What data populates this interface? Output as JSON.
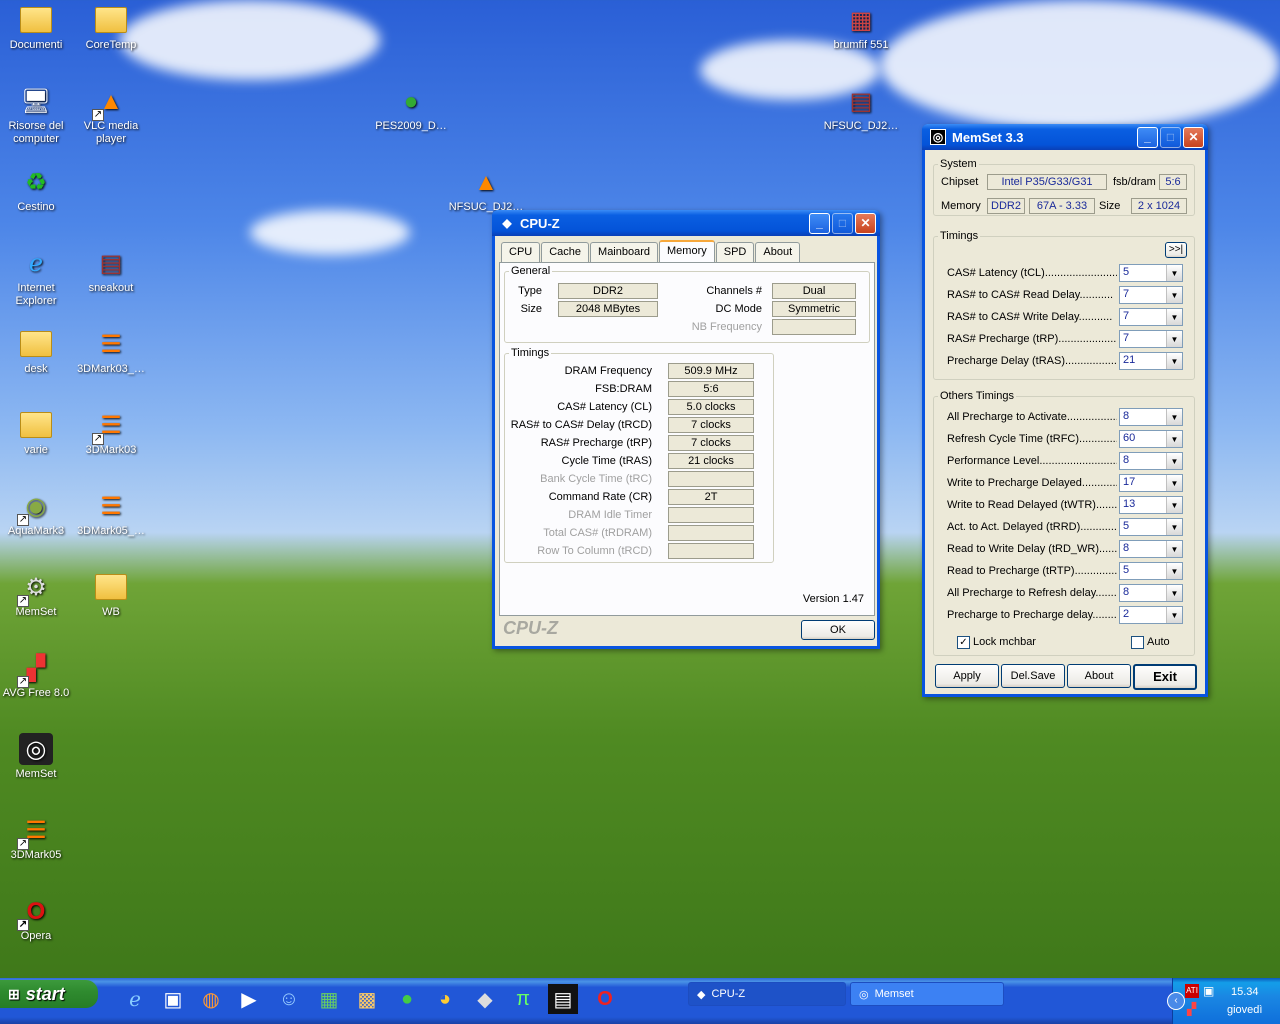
{
  "desktop": {
    "icons": [
      {
        "label": "Documenti",
        "icon": "folder-docs-icon"
      },
      {
        "label": "CoreTemp",
        "icon": "folder-icon"
      },
      {
        "label": "brumfif 551",
        "icon": "file-icon"
      },
      {
        "label": "Risorse del computer",
        "icon": "computer-icon"
      },
      {
        "label": "VLC media player",
        "icon": "vlc-icon"
      },
      {
        "label": "PES2009_D…",
        "icon": "utorrent-icon"
      },
      {
        "label": "NFSUC_DJ2…",
        "icon": "rar-icon"
      },
      {
        "label": "Cestino",
        "icon": "recycle-bin-icon"
      },
      {
        "label": "NFSUC_DJ2…",
        "icon": "vlc-icon"
      },
      {
        "label": "Internet Explorer",
        "icon": "ie-icon"
      },
      {
        "label": "sneakout",
        "icon": "rar-icon"
      },
      {
        "label": "desk",
        "icon": "folder-icon"
      },
      {
        "label": "3DMark03_…",
        "icon": "3dmark-icon"
      },
      {
        "label": "varie",
        "icon": "folder-icon"
      },
      {
        "label": "3DMark03",
        "icon": "3dmark-icon"
      },
      {
        "label": "AquaMark3",
        "icon": "aquamark-icon"
      },
      {
        "label": "3DMark05_…",
        "icon": "3dmark-icon"
      },
      {
        "label": "MemSet",
        "icon": "memset-setup-icon"
      },
      {
        "label": "WB",
        "icon": "folder-icon"
      },
      {
        "label": "AVG Free 8.0",
        "icon": "avg-icon"
      },
      {
        "label": "MemSet",
        "icon": "memset-icon"
      },
      {
        "label": "3DMark05",
        "icon": "3dmark-icon"
      },
      {
        "label": "Opera",
        "icon": "opera-icon"
      }
    ]
  },
  "cpuz": {
    "title": "CPU-Z",
    "tabs": [
      "CPU",
      "Cache",
      "Mainboard",
      "Memory",
      "SPD",
      "About"
    ],
    "active_tab": "Memory",
    "general": {
      "legend": "General",
      "type_label": "Type",
      "type": "DDR2",
      "size_label": "Size",
      "size": "2048 MBytes",
      "channels_label": "Channels #",
      "channels": "Dual",
      "dcmode_label": "DC Mode",
      "dcmode": "Symmetric",
      "nbfreq_label": "NB Frequency",
      "nbfreq": ""
    },
    "timings": {
      "legend": "Timings",
      "rows": [
        {
          "label": "DRAM Frequency",
          "value": "509.9 MHz",
          "dim": false
        },
        {
          "label": "FSB:DRAM",
          "value": "5:6",
          "dim": false
        },
        {
          "label": "CAS# Latency (CL)",
          "value": "5.0 clocks",
          "dim": false
        },
        {
          "label": "RAS# to CAS# Delay (tRCD)",
          "value": "7 clocks",
          "dim": false
        },
        {
          "label": "RAS# Precharge (tRP)",
          "value": "7 clocks",
          "dim": false
        },
        {
          "label": "Cycle Time (tRAS)",
          "value": "21 clocks",
          "dim": false
        },
        {
          "label": "Bank Cycle Time (tRC)",
          "value": "",
          "dim": true
        },
        {
          "label": "Command Rate (CR)",
          "value": "2T",
          "dim": false
        },
        {
          "label": "DRAM Idle Timer",
          "value": "",
          "dim": true
        },
        {
          "label": "Total CAS# (tRDRAM)",
          "value": "",
          "dim": true
        },
        {
          "label": "Row To Column (tRCD)",
          "value": "",
          "dim": true
        }
      ]
    },
    "version": "Version 1.47",
    "brand": "CPU-Z",
    "ok_label": "OK"
  },
  "memset": {
    "title": "MemSet 3.3",
    "system": {
      "legend": "System",
      "chipset_label": "Chipset",
      "chipset": "Intel P35/G33/G31",
      "fsbdram_label": "fsb/dram",
      "fsbdram": "5:6",
      "memory_label": "Memory",
      "memory_type": "DDR2",
      "memory_speed": "67A - 3.33",
      "size_label": "Size",
      "size": "2 x 1024"
    },
    "timings": {
      "legend": "Timings",
      "more": ">>|",
      "rows": [
        {
          "label": "CAS# Latency (tCL)............................",
          "value": "5"
        },
        {
          "label": "RAS# to CAS# Read Delay...........",
          "value": "7"
        },
        {
          "label": "RAS# to CAS# Write Delay...........",
          "value": "7"
        },
        {
          "label": "RAS# Precharge (tRP)...........................",
          "value": "7"
        },
        {
          "label": "Precharge Delay  (tRAS)........................",
          "value": "21"
        }
      ]
    },
    "others": {
      "legend": "Others Timings",
      "rows": [
        {
          "label": "All Precharge to Activate.......................",
          "value": "8"
        },
        {
          "label": "Refresh Cycle Time (tRFC)...................",
          "value": "60"
        },
        {
          "label": "Performance Level.................................",
          "value": "8"
        },
        {
          "label": "Write to Precharge Delayed...................",
          "value": "17"
        },
        {
          "label": "Write to Read Delayed (tWTR)................",
          "value": "13"
        },
        {
          "label": "Act. to Act. Delayed (tRRD)...................",
          "value": "5"
        },
        {
          "label": "Read to Write Delay (tRD_WR)................",
          "value": "8"
        },
        {
          "label": "Read to Precharge (tRTP)......................",
          "value": "5"
        },
        {
          "label": "All Precharge to Refresh delay...............",
          "value": "8"
        },
        {
          "label": "Precharge to Precharge delay..............",
          "value": "2"
        }
      ]
    },
    "lock_label": "Lock mchbar",
    "lock_checked": true,
    "auto_label": "Auto",
    "auto_checked": false,
    "buttons": {
      "apply": "Apply",
      "delsave": "Del.Save",
      "about": "About",
      "exit": "Exit"
    }
  },
  "taskbar": {
    "start_label": "start",
    "tasks": [
      {
        "label": "CPU-Z"
      },
      {
        "label": "Memset"
      }
    ],
    "clock_time": "15.34",
    "clock_day": "giovedì"
  }
}
